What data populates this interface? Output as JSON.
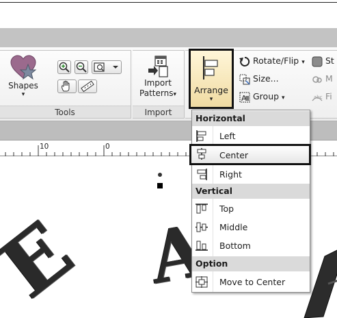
{
  "ribbon": {
    "tools_group": {
      "label": "Tools",
      "shapes_label": "Shapes",
      "shapes_arrow": "▾",
      "zoom_in_icon": "zoom-in-icon",
      "zoom_out_icon": "zoom-out-icon",
      "zoom_to_fit_icon": "zoom-fit-icon",
      "pan_icon": "hand-icon",
      "measure_icon": "ruler-icon"
    },
    "import_group": {
      "label": "Import",
      "button_label_line1": "Import",
      "button_label_line2": "Patterns",
      "button_arrow": "▾"
    },
    "arrange_group": {
      "arrange_label": "Arrange",
      "arrange_arrow": "▾",
      "rotate_flip_label": "Rotate/Flip",
      "size_label": "Size...",
      "group_label": "Group",
      "dropdown_arrow": "▾",
      "partial_labels": [
        "St",
        "M",
        "Fi"
      ]
    }
  },
  "ruler": {
    "labels": [
      "10",
      "0"
    ]
  },
  "canvas": {
    "glyphs": [
      "E",
      "A"
    ]
  },
  "menu": {
    "sections": [
      {
        "header": "Horizontal",
        "items": [
          {
            "label": "Left",
            "icon": "align-left-icon"
          },
          {
            "label": "Center",
            "icon": "align-center-icon",
            "selected": true
          },
          {
            "label": "Right",
            "icon": "align-right-icon"
          }
        ]
      },
      {
        "header": "Vertical",
        "items": [
          {
            "label": "Top",
            "icon": "align-top-icon"
          },
          {
            "label": "Middle",
            "icon": "align-middle-icon"
          },
          {
            "label": "Bottom",
            "icon": "align-bottom-icon"
          }
        ]
      },
      {
        "header": "Option",
        "items": [
          {
            "label": "Move to Center",
            "icon": "move-to-center-icon"
          }
        ]
      }
    ]
  },
  "colors": {
    "ribbon_band": "#c3c3c3",
    "selection_fill": "#f0dba2",
    "menu_header": "#dadada",
    "accent_blue": "#3a6fc4"
  }
}
